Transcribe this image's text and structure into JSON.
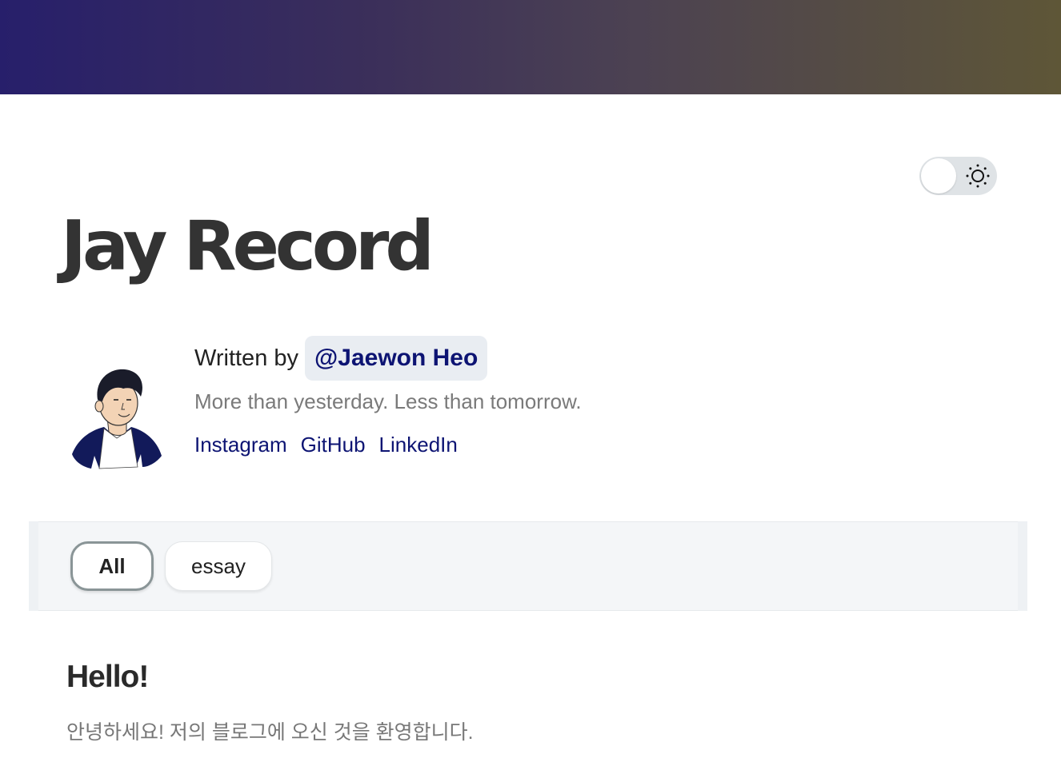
{
  "theme": {
    "banner_gradient": [
      "#271f6b",
      "#5e5637"
    ],
    "accent": "#0d1473",
    "toggle_icon": "sun-icon"
  },
  "site": {
    "title": "Jay Record"
  },
  "author": {
    "written_by": "Written by",
    "handle": "@Jaewon Heo",
    "tagline": "More than yesterday. Less than tomorrow.",
    "avatar_icon": "avatar-illustration",
    "links": [
      {
        "label": "Instagram"
      },
      {
        "label": "GitHub"
      },
      {
        "label": "LinkedIn"
      }
    ]
  },
  "categories": {
    "items": [
      {
        "label": "All",
        "selected": true
      },
      {
        "label": "essay",
        "selected": false
      }
    ]
  },
  "posts": [
    {
      "title": "Hello!",
      "excerpt": "안녕하세요! 저의 블로그에 오신 것을 환영합니다."
    }
  ]
}
